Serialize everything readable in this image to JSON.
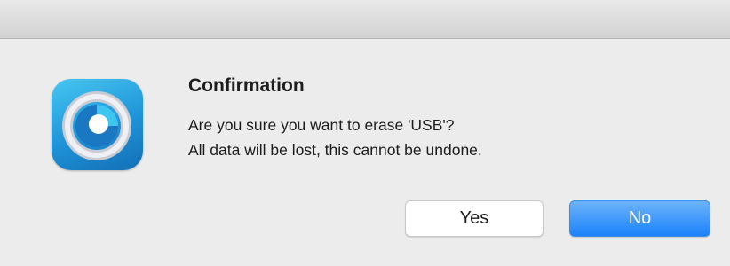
{
  "dialog": {
    "icon": "app-disc-icon",
    "title": "Confirmation",
    "message_line1": "Are you sure you want to erase 'USB'?",
    "message_line2": "All data will be lost, this cannot be undone."
  },
  "buttons": {
    "yes_label": "Yes",
    "no_label": "No"
  },
  "colors": {
    "default_button": "#1a82fb",
    "icon_accent": "#1f93d8"
  }
}
